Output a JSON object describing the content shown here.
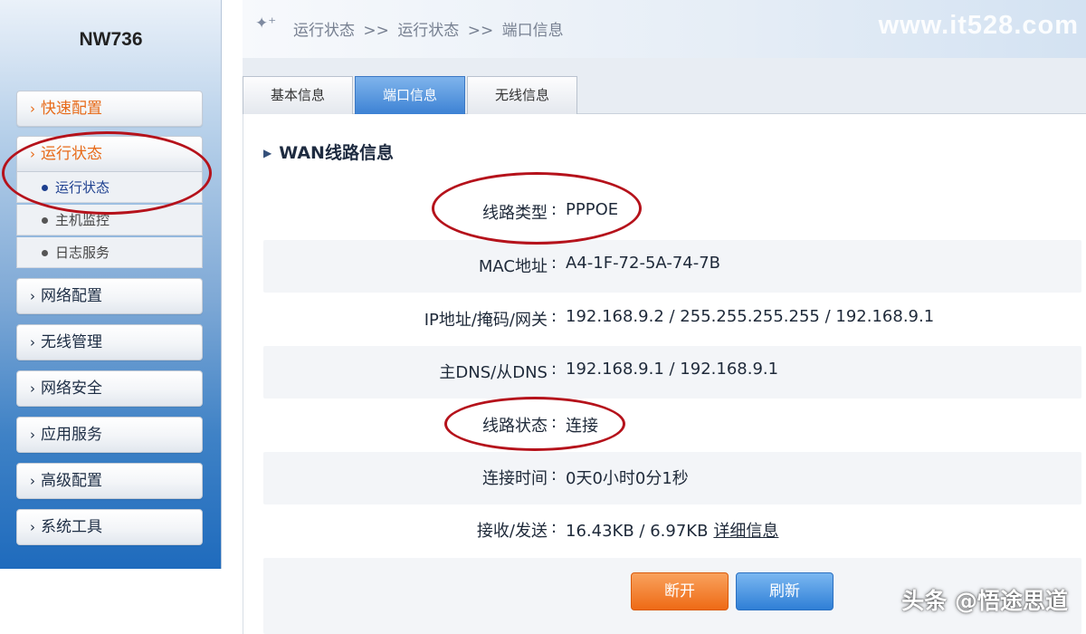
{
  "sidebar": {
    "brand": "NW736",
    "menu": [
      {
        "label": "快速配置",
        "icon": "chevron-right-icon"
      },
      {
        "label": "运行状态",
        "icon": "chevron-right-icon"
      },
      {
        "label": "网络配置",
        "icon": "chevron-right-icon"
      },
      {
        "label": "无线管理",
        "icon": "chevron-right-icon"
      },
      {
        "label": "网络安全",
        "icon": "chevron-right-icon"
      },
      {
        "label": "应用服务",
        "icon": "chevron-right-icon"
      },
      {
        "label": "高级配置",
        "icon": "chevron-right-icon"
      },
      {
        "label": "系统工具",
        "icon": "chevron-right-icon"
      }
    ],
    "sub_items": [
      {
        "label": "运行状态",
        "active": true
      },
      {
        "label": "主机监控",
        "active": false
      },
      {
        "label": "日志服务",
        "active": false
      }
    ]
  },
  "header": {
    "icon": "sparkle-icon",
    "breadcrumb": [
      "运行状态",
      ">>",
      "运行状态",
      ">>",
      "端口信息"
    ],
    "watermark": "www.it528.com"
  },
  "tabs": [
    {
      "label": "基本信息",
      "active": false
    },
    {
      "label": "端口信息",
      "active": true
    },
    {
      "label": "无线信息",
      "active": false
    }
  ],
  "main": {
    "section_title": "WAN线路信息",
    "fields": [
      {
        "label": "线路类型",
        "value": "PPPOE"
      },
      {
        "label": "MAC地址",
        "value": "A4-1F-72-5A-74-7B"
      },
      {
        "label": "IP地址/掩码/网关",
        "value": "192.168.9.2 / 255.255.255.255 / 192.168.9.1"
      },
      {
        "label": "主DNS/从DNS",
        "value": "192.168.9.1 / 192.168.9.1"
      },
      {
        "label": "线路状态",
        "value": "连接"
      },
      {
        "label": "连接时间",
        "value": "0天0小时0分1秒"
      },
      {
        "label": "接收/发送",
        "value": "16.43KB / 6.97KB",
        "link": "详细信息"
      }
    ],
    "colon": ":",
    "buttons": {
      "disconnect": "断开",
      "refresh": "刷新"
    }
  },
  "watermark_bottom": "头条 @悟途思道",
  "colors": {
    "accent_orange": "#ee6a15",
    "accent_blue": "#3d82d4",
    "highlight_red": "#b5121b",
    "sidebar_blue": "#1f6bbd"
  }
}
